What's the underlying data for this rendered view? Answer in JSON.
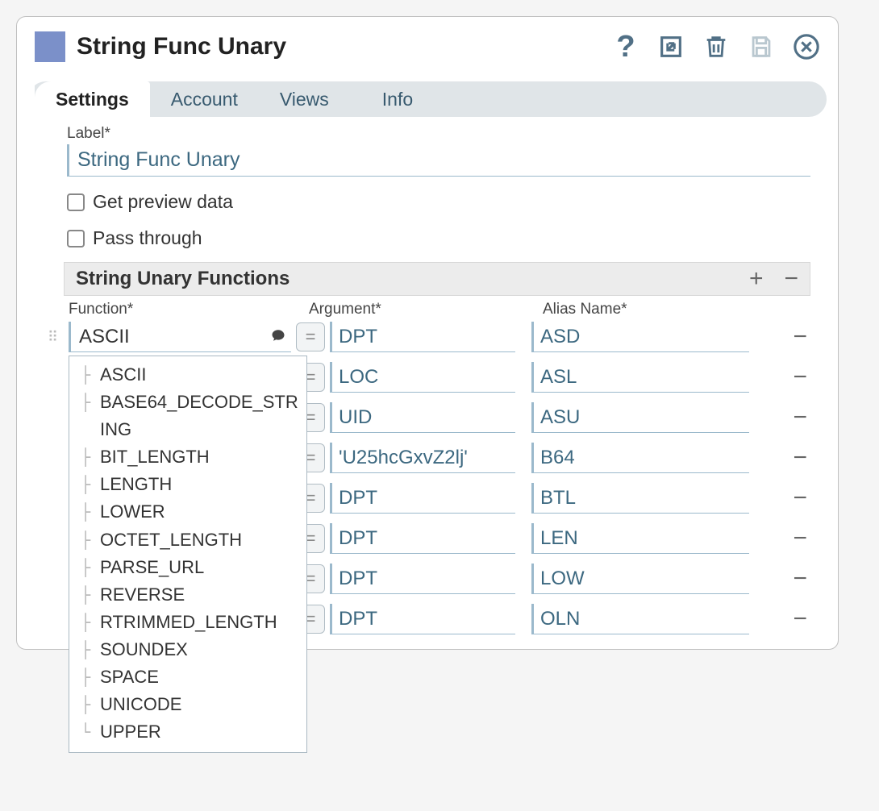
{
  "title": "String Func Unary",
  "tabs": [
    "Settings",
    "Account",
    "Views",
    "Info"
  ],
  "activeTab": 0,
  "labels": {
    "label": "Label*",
    "getPreview": "Get preview data",
    "passThrough": "Pass through",
    "section": "String Unary Functions",
    "funcHeader": "Function*",
    "argHeader": "Argument*",
    "aliasHeader": "Alias Name*"
  },
  "labelValue": "String Func Unary",
  "firstRow": {
    "function": "ASCII",
    "argument": "DPT",
    "alias": "ASD"
  },
  "rows": [
    {
      "argument": "LOC",
      "alias": "ASL"
    },
    {
      "argument": "UID",
      "alias": "ASU"
    },
    {
      "argument": "'U25hcGxvZ2lj'",
      "alias": "B64"
    },
    {
      "argument": "DPT",
      "alias": "BTL"
    },
    {
      "argument": "DPT",
      "alias": "LEN"
    },
    {
      "argument": "DPT",
      "alias": "LOW"
    },
    {
      "argument": "DPT",
      "alias": "OLN"
    }
  ],
  "dropdownOptions": [
    "ASCII",
    "BASE64_DECODE_STRING",
    "BIT_LENGTH",
    "LENGTH",
    "LOWER",
    "OCTET_LENGTH",
    "PARSE_URL",
    "REVERSE",
    "RTRIMMED_LENGTH",
    "SOUNDEX",
    "SPACE",
    "UNICODE",
    "UPPER"
  ]
}
